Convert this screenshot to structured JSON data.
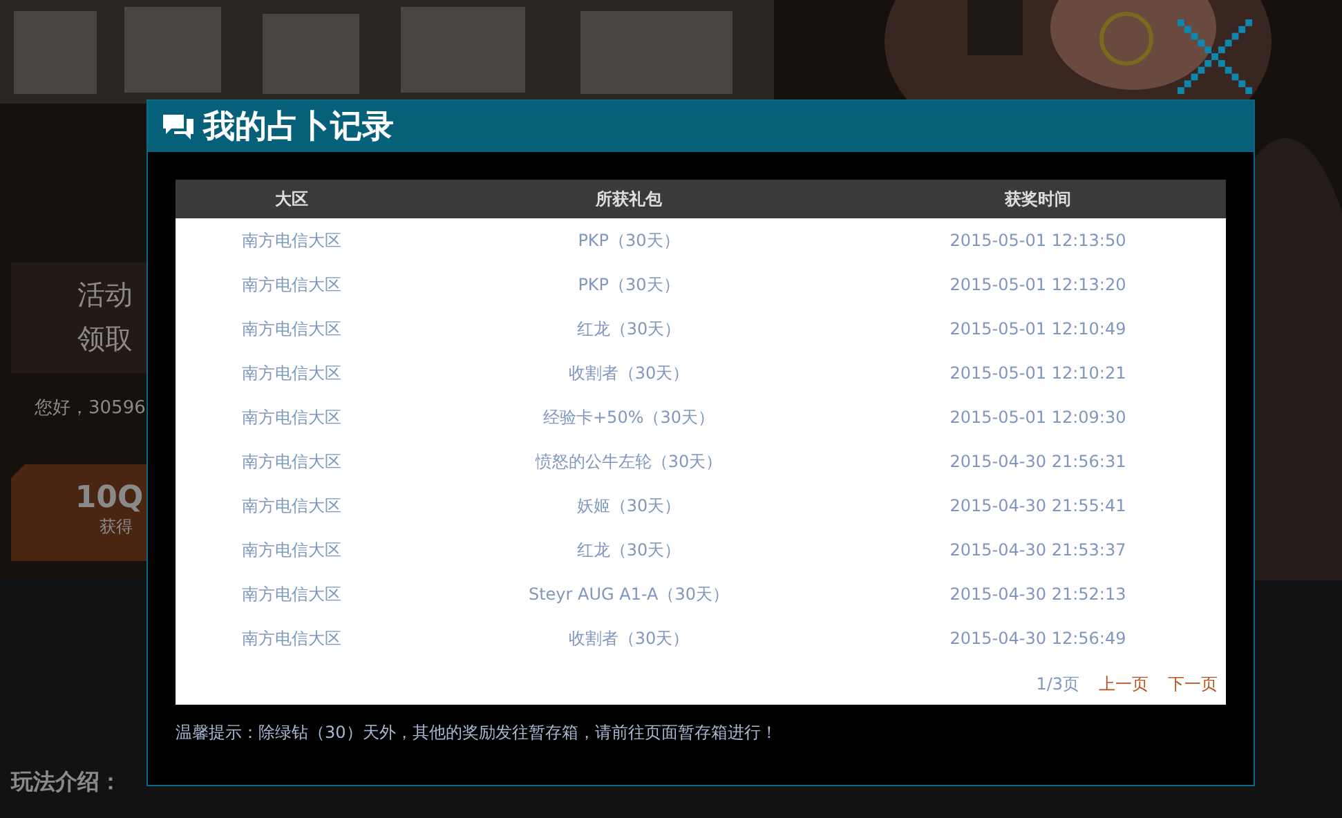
{
  "page": {
    "event_time_label": "活动",
    "claim_time_label": "领取",
    "greeting": "您好，30596",
    "reward_title": "10Q",
    "reward_caption": "获得",
    "rules_heading": "玩法介绍："
  },
  "dialog": {
    "title": "我的占卜记录",
    "columns": [
      "大区",
      "所获礼包",
      "获奖时间"
    ],
    "rows": [
      {
        "region": "南方电信大区",
        "gift": "PKP（30天）",
        "time": "2015-05-01 12:13:50"
      },
      {
        "region": "南方电信大区",
        "gift": "PKP（30天）",
        "time": "2015-05-01 12:13:20"
      },
      {
        "region": "南方电信大区",
        "gift": "红龙（30天）",
        "time": "2015-05-01 12:10:49"
      },
      {
        "region": "南方电信大区",
        "gift": "收割者（30天）",
        "time": "2015-05-01 12:10:21"
      },
      {
        "region": "南方电信大区",
        "gift": "经验卡+50%（30天）",
        "time": "2015-05-01 12:09:30"
      },
      {
        "region": "南方电信大区",
        "gift": "愤怒的公牛左轮（30天）",
        "time": "2015-04-30 21:56:31"
      },
      {
        "region": "南方电信大区",
        "gift": "妖姬（30天）",
        "time": "2015-04-30 21:55:41"
      },
      {
        "region": "南方电信大区",
        "gift": "红龙（30天）",
        "time": "2015-04-30 21:53:37"
      },
      {
        "region": "南方电信大区",
        "gift": "Steyr AUG A1-A（30天）",
        "time": "2015-04-30 21:52:13"
      },
      {
        "region": "南方电信大区",
        "gift": "收割者（30天）",
        "time": "2015-04-30 12:56:49"
      }
    ],
    "pagination": {
      "page": "1/3页",
      "prev": "上一页",
      "next": "下一页"
    },
    "tip": "温馨提示：除绿钻（30）天外，其他的奖励发往暂存箱，请前往页面暂存箱进行！"
  }
}
